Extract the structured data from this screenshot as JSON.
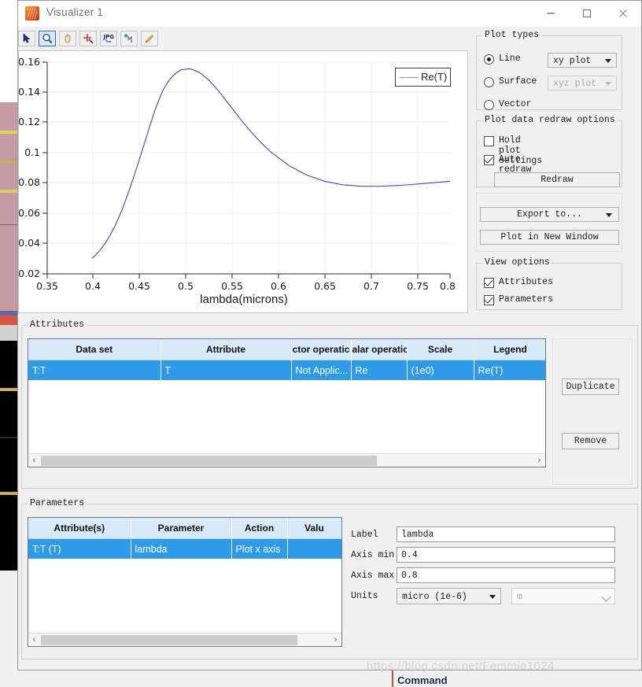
{
  "window": {
    "title": "Visualizer 1",
    "icon": "app-flame-icon",
    "minimize": "minimize-icon",
    "maximize": "maximize-icon",
    "close": "close-icon"
  },
  "toolbar": {
    "buttons": [
      {
        "name": "pointer-tool",
        "icon": "cursor-arrow-icon",
        "selected": false
      },
      {
        "name": "zoom-tool",
        "icon": "magnifier-icon",
        "selected": true
      },
      {
        "name": "pan-tool",
        "icon": "hand-icon",
        "selected": false
      },
      {
        "name": "zoom-fit-tool",
        "icon": "move-arrows-icon",
        "selected": false
      },
      {
        "name": "export-jpg-tool",
        "icon": "jpg-icon",
        "selected": false
      },
      {
        "name": "marker-tool",
        "icon": "marker-m-icon",
        "selected": false
      },
      {
        "name": "annotate-tool",
        "icon": "pencil-icon",
        "selected": false
      }
    ]
  },
  "chart_data": {
    "type": "line",
    "title": "",
    "xlabel": "lambda(microns)",
    "ylabel": "",
    "xlim": [
      0.35,
      0.8
    ],
    "ylim": [
      0.02,
      0.16
    ],
    "xticks": [
      "0.35",
      "0.4",
      "0.45",
      "0.5",
      "0.55",
      "0.6",
      "0.65",
      "0.7",
      "0.75",
      "0.8"
    ],
    "xtick_values": [
      0.35,
      0.4,
      0.45,
      0.5,
      0.55,
      0.6,
      0.65,
      0.7,
      0.75,
      0.8
    ],
    "yticks": [
      "0.02",
      "0.04",
      "0.06",
      "0.08",
      "0.1",
      "0.12",
      "0.14",
      "0.16"
    ],
    "ytick_values": [
      0.02,
      0.04,
      0.06,
      0.08,
      0.1,
      0.12,
      0.14,
      0.16
    ],
    "grid": true,
    "legend": {
      "position": "top-right",
      "entries": [
        "Re(T)"
      ]
    },
    "line_color": "#4040e0",
    "series": [
      {
        "name": "Re(T)",
        "x": [
          0.4,
          0.405,
          0.41,
          0.415,
          0.42,
          0.425,
          0.43,
          0.435,
          0.44,
          0.445,
          0.45,
          0.455,
          0.46,
          0.465,
          0.47,
          0.475,
          0.48,
          0.485,
          0.49,
          0.495,
          0.5,
          0.51,
          0.52,
          0.53,
          0.54,
          0.55,
          0.56,
          0.57,
          0.58,
          0.59,
          0.6,
          0.62,
          0.64,
          0.66,
          0.68,
          0.7,
          0.72,
          0.74,
          0.76,
          0.78,
          0.8
        ],
        "y": [
          0.0302,
          0.033,
          0.0364,
          0.0404,
          0.0452,
          0.0508,
          0.0572,
          0.0645,
          0.0726,
          0.0812,
          0.0902,
          0.0995,
          0.109,
          0.1185,
          0.1275,
          0.1355,
          0.1421,
          0.1471,
          0.1507,
          0.1533,
          0.1551,
          0.1556,
          0.1533,
          0.1485,
          0.142,
          0.1345,
          0.1268,
          0.1193,
          0.1124,
          0.1061,
          0.1005,
          0.0916,
          0.0853,
          0.0812,
          0.0789,
          0.078,
          0.0779,
          0.0784,
          0.0792,
          0.0802,
          0.0812
        ]
      }
    ]
  },
  "plot_types": {
    "title": "Plot types",
    "options": [
      {
        "label": "Line",
        "selected": true
      },
      {
        "label": "Surface",
        "selected": false
      },
      {
        "label": "Vector",
        "selected": false
      }
    ],
    "line_combo": {
      "value": "xy plot",
      "enabled": true
    },
    "surface_combo": {
      "value": "xyz plot",
      "enabled": false
    }
  },
  "redraw_options": {
    "title": "Plot data redraw options",
    "hold_plot_settings": {
      "label": "Hold plot settings",
      "checked": false
    },
    "auto_redraw": {
      "label": "Auto redraw",
      "checked": true
    },
    "redraw_button": "Redraw"
  },
  "actions": {
    "export_to": "Export to...",
    "plot_in_new_window": "Plot in New Window"
  },
  "view_options": {
    "title": "View options",
    "attributes": {
      "label": "Attributes",
      "checked": true
    },
    "parameters": {
      "label": "Parameters",
      "checked": true
    }
  },
  "attributes_panel": {
    "title": "Attributes",
    "columns": [
      "Data set",
      "Attribute",
      "ctor operatic",
      "alar operatic",
      "Scale",
      "Legend"
    ],
    "rows": [
      {
        "data_set": "T:T",
        "attribute": "T",
        "vector_operation": "Not Applic...",
        "scalar_operation": "Re",
        "scale": "(1e0)",
        "legend": "Re(T)"
      }
    ],
    "duplicate_button": "Duplicate",
    "remove_button": "Remove",
    "scroll_left": "‹",
    "scroll_right": "›"
  },
  "parameters_panel": {
    "title": "Parameters",
    "columns": [
      "Attribute(s)",
      "Parameter",
      "Action",
      "Valu"
    ],
    "rows": [
      {
        "attributes": "T:T (T)",
        "parameter": "lambda",
        "action": "Plot x axis",
        "value": ""
      }
    ],
    "scroll_left": "‹",
    "scroll_right": "›",
    "fields": {
      "label": {
        "caption": "Label",
        "value": "lambda"
      },
      "axis_min": {
        "caption": "Axis min",
        "value": "0.4"
      },
      "axis_max": {
        "caption": "Axis max",
        "value": "0.8"
      },
      "units": {
        "caption": "Units",
        "value": "micro (1e-6)",
        "unit_value": "m",
        "unit_enabled": false
      }
    }
  },
  "background": {
    "watermark": "https://blog.csdn.net/Femmie1024",
    "command_label": "Command"
  },
  "colors": {
    "selection_blue": "#2e9be8",
    "header_blue": "#d6eaf8",
    "curve": "#4040e0",
    "accent": "#2a6ec4"
  }
}
